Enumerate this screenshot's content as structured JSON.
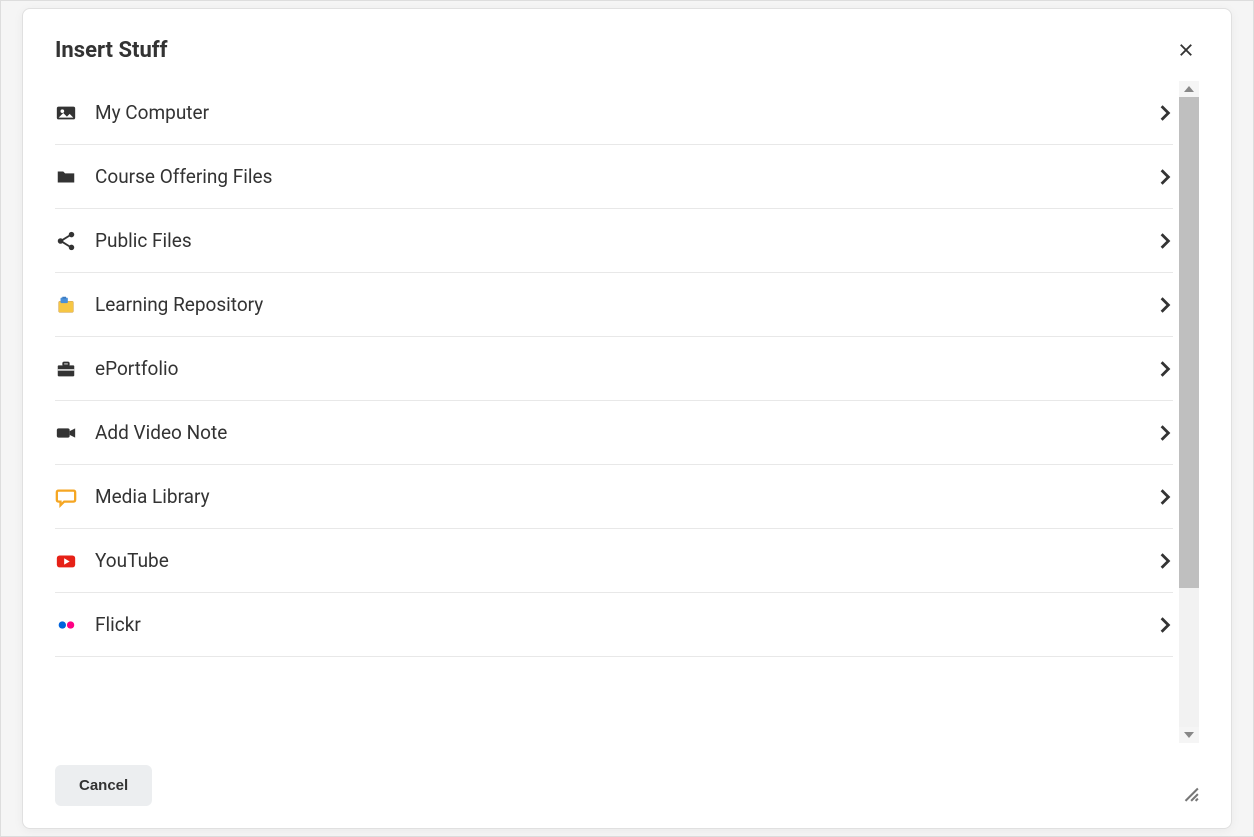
{
  "dialog": {
    "title": "Insert Stuff",
    "items": [
      {
        "id": "my-computer",
        "label": "My Computer",
        "icon": "image"
      },
      {
        "id": "course-files",
        "label": "Course Offering Files",
        "icon": "folder"
      },
      {
        "id": "public-files",
        "label": "Public Files",
        "icon": "share"
      },
      {
        "id": "learning-repo",
        "label": "Learning Repository",
        "icon": "repo"
      },
      {
        "id": "eportfolio",
        "label": "ePortfolio",
        "icon": "briefcase"
      },
      {
        "id": "video-note",
        "label": "Add Video Note",
        "icon": "camera"
      },
      {
        "id": "media-library",
        "label": "Media Library",
        "icon": "speech"
      },
      {
        "id": "youtube",
        "label": "YouTube",
        "icon": "youtube"
      },
      {
        "id": "flickr",
        "label": "Flickr",
        "icon": "flickr"
      }
    ],
    "footer": {
      "cancel_label": "Cancel"
    }
  }
}
